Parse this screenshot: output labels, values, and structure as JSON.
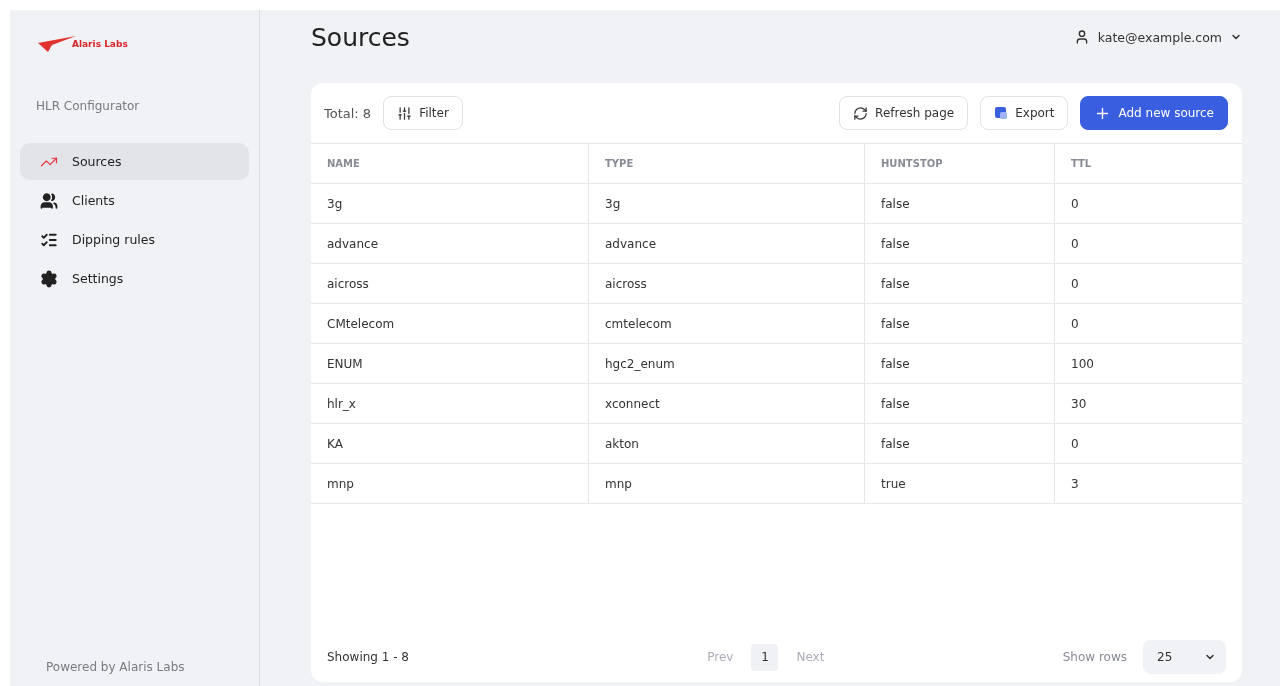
{
  "sidebar": {
    "logo": "Alaris Labs",
    "app_name": "HLR Configurator",
    "items": [
      {
        "label": "Sources",
        "selected": true
      },
      {
        "label": "Clients",
        "selected": false
      },
      {
        "label": "Dipping rules",
        "selected": false
      },
      {
        "label": "Settings",
        "selected": false
      }
    ],
    "footer": "Powered by Alaris Labs"
  },
  "header": {
    "title": "Sources",
    "user": "kate@example.com"
  },
  "toolbar": {
    "total": "Total: 8",
    "filter": "Filter",
    "refresh": "Refresh page",
    "export": "Export",
    "add": "Add new source"
  },
  "table": {
    "columns": [
      "NAME",
      "TYPE",
      "HUNTSTOP",
      "TTL"
    ],
    "rows": [
      [
        "3g",
        "3g",
        "false",
        "0"
      ],
      [
        "advance",
        "advance",
        "false",
        "0"
      ],
      [
        "aicross",
        "aicross",
        "false",
        "0"
      ],
      [
        "CMtelecom",
        "cmtelecom",
        "false",
        "0"
      ],
      [
        "ENUM",
        "hgc2_enum",
        "false",
        "100"
      ],
      [
        "hlr_x",
        "xconnect",
        "false",
        "30"
      ],
      [
        "KA",
        "akton",
        "false",
        "0"
      ],
      [
        "mnp",
        "mnp",
        "true",
        "3"
      ]
    ]
  },
  "footer": {
    "showing": "Showing 1 - 8",
    "prev": "Prev",
    "pages": [
      {
        "label": "1",
        "selected": true
      }
    ],
    "next": "Next",
    "rows_label": "Show rows",
    "rows_value": "25"
  }
}
